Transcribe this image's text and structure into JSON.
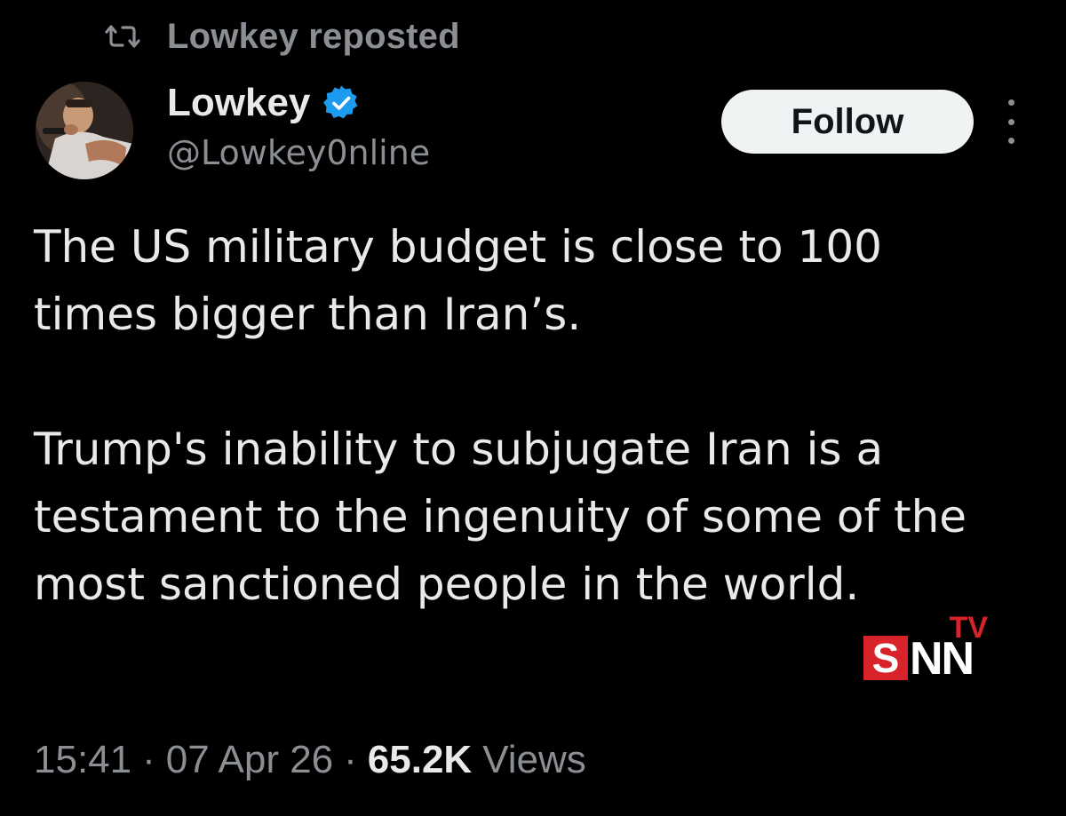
{
  "repost": {
    "icon": "repost-icon",
    "text": "Lowkey reposted"
  },
  "author": {
    "avatar": "avatar",
    "display_name": "Lowkey",
    "verified_icon": "verified-badge-icon",
    "verified_color": "#1d9bf0",
    "handle": "@Lowkey0nline"
  },
  "actions": {
    "follow_label": "Follow",
    "more_icon": "more-options-icon"
  },
  "tweet": {
    "paragraphs": [
      "The US military budget is close to 100 times bigger than Iran’s.",
      "Trump's inability to subjugate Iran is a testament to the ingenuity of some of the most sanctioned people in the world."
    ]
  },
  "meta": {
    "time": "15:41",
    "separator": "·",
    "date": "07 Apr 26",
    "views_count": "65.2K",
    "views_label": "Views"
  },
  "watermark": {
    "tv": "TV",
    "s": "S",
    "nn": "NN",
    "accent_color": "#d8232a"
  },
  "colors": {
    "background": "#000000",
    "primary_text": "#e7e9ea",
    "secondary_text": "#8b8f94"
  }
}
